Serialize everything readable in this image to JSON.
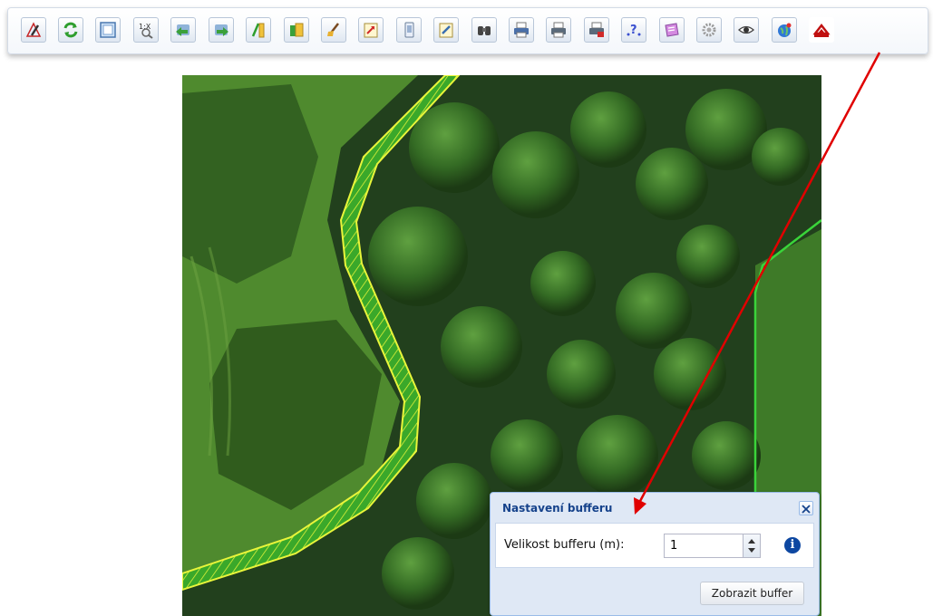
{
  "toolbar": {
    "icons": [
      "edit-geometry-icon",
      "refresh-icon",
      "zoom-to-extent-icon",
      "scale-1x-icon",
      "back-icon",
      "forward-icon",
      "measure-icon",
      "layers-icon",
      "clean-icon",
      "export-icon",
      "document-icon",
      "edit-note-icon",
      "binoculars-icon",
      "print-icon",
      "print-preview-icon",
      "print-pdf-icon",
      "help-icon",
      "legend-icon",
      "settings-icon",
      "visibility-eye-icon",
      "globe-icon",
      "buffer-icon"
    ]
  },
  "buffer_panel": {
    "title": "Nastavení bufferu",
    "close_glyph": "✕",
    "size_label": "Velikost bufferu (m):",
    "size_value": "1",
    "info_glyph": "i",
    "submit_label": "Zobrazit buffer"
  },
  "colors": {
    "annotation_arrow": "#e00000",
    "buffer_line": "#e8f53a",
    "parcel_line": "#22c822",
    "panel_title": "#15428b"
  }
}
